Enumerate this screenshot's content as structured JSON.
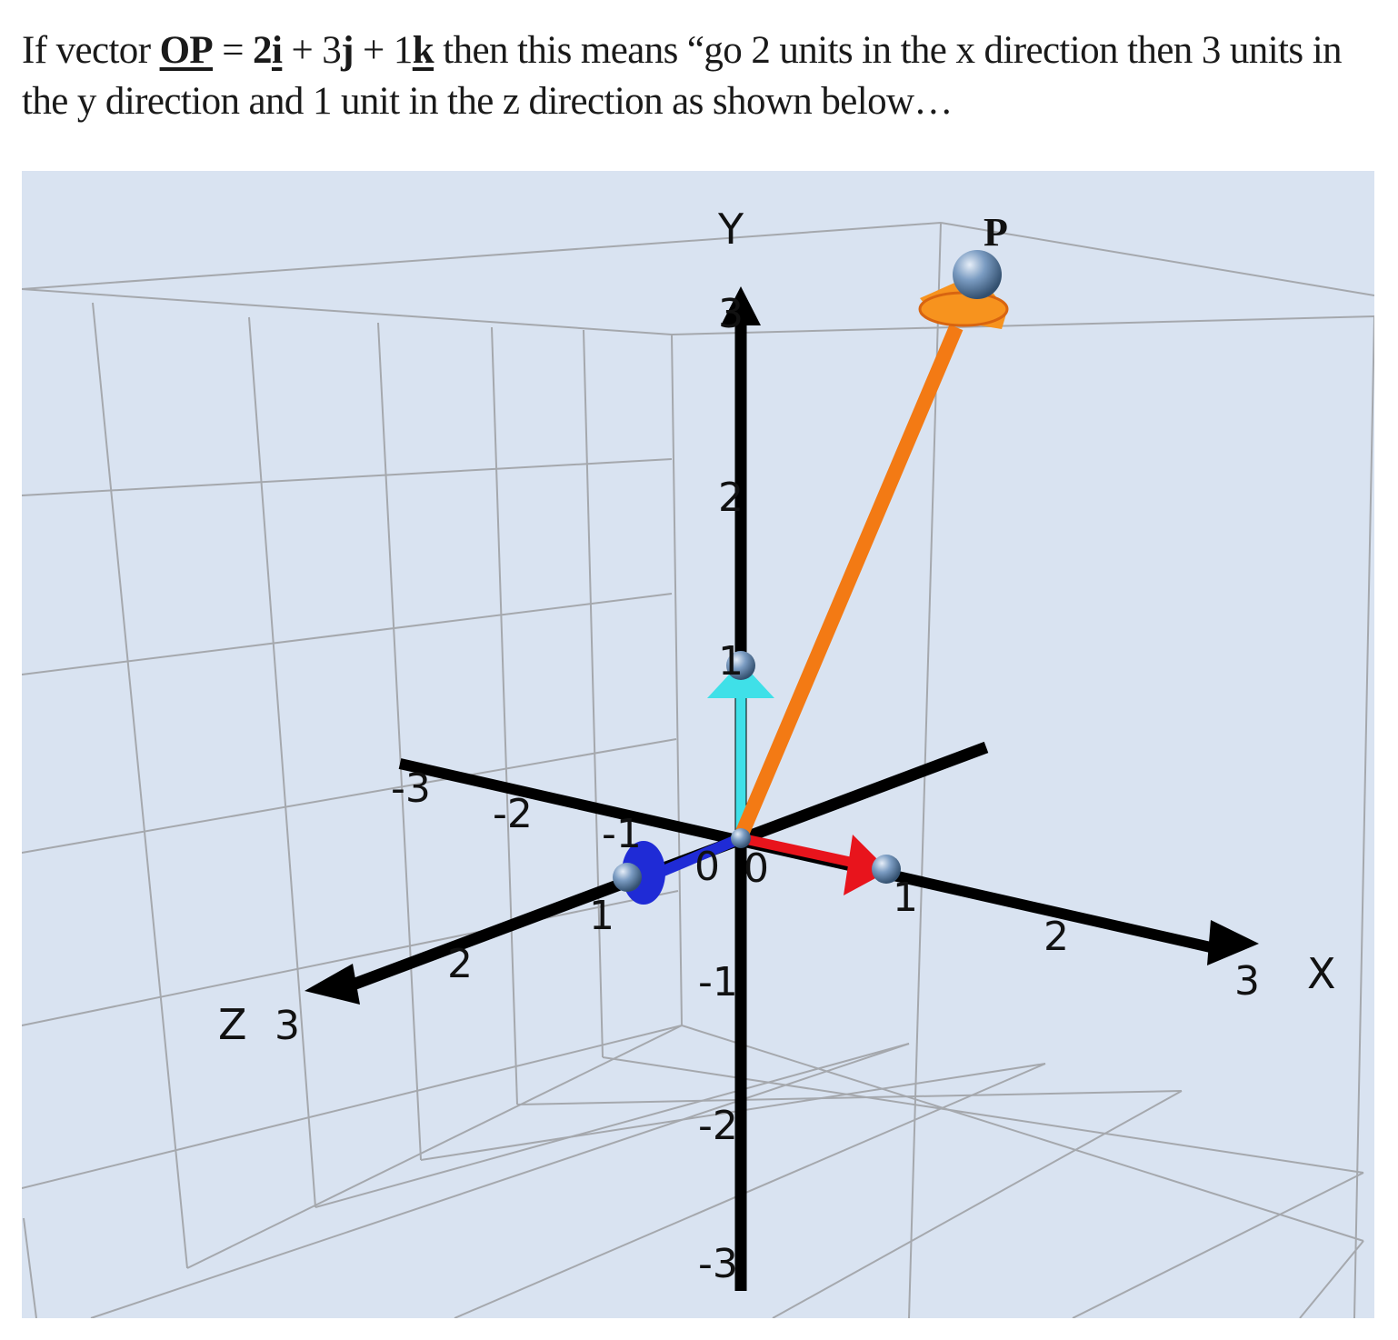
{
  "caption": {
    "t1": "If vector ",
    "vec": "OP",
    "t2": " = ",
    "c1": "2",
    "u1": "i",
    "t3": " + 3",
    "u2": "j",
    "t4": " + 1",
    "u3": "k",
    "t5": " then this means “go 2 units in the x direction then 3 units in the y direction and 1 unit in the z direction as shown below…"
  },
  "scene": {
    "axis_labels": {
      "x": "X",
      "y": "Y",
      "z": "Z"
    },
    "point_label": "P",
    "colors": {
      "background": "#d9e3f1",
      "grid": "#a5a8ad",
      "axes": "#000000",
      "x_component": "#e8141c",
      "y_component": "#3fe0e8",
      "z_component": "#1f2bd6",
      "result_vector": "#f37a14",
      "sphere": "#6e8fb5"
    },
    "x_ticks": [
      "-3",
      "-2",
      "-1",
      "0",
      "1",
      "2",
      "3"
    ],
    "y_ticks": [
      "-3",
      "-2",
      "-1",
      "0",
      "1",
      "2",
      "3"
    ],
    "z_ticks": [
      "0",
      "1",
      "2",
      "3"
    ]
  }
}
